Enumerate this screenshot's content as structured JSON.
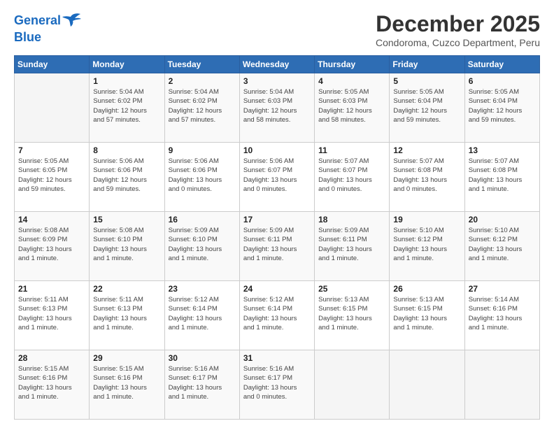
{
  "logo": {
    "line1": "General",
    "line2": "Blue"
  },
  "header": {
    "month": "December 2025",
    "location": "Condoroma, Cuzco Department, Peru"
  },
  "days_of_week": [
    "Sunday",
    "Monday",
    "Tuesday",
    "Wednesday",
    "Thursday",
    "Friday",
    "Saturday"
  ],
  "weeks": [
    [
      {
        "day": "",
        "info": ""
      },
      {
        "day": "1",
        "info": "Sunrise: 5:04 AM\nSunset: 6:02 PM\nDaylight: 12 hours\nand 57 minutes."
      },
      {
        "day": "2",
        "info": "Sunrise: 5:04 AM\nSunset: 6:02 PM\nDaylight: 12 hours\nand 57 minutes."
      },
      {
        "day": "3",
        "info": "Sunrise: 5:04 AM\nSunset: 6:03 PM\nDaylight: 12 hours\nand 58 minutes."
      },
      {
        "day": "4",
        "info": "Sunrise: 5:05 AM\nSunset: 6:03 PM\nDaylight: 12 hours\nand 58 minutes."
      },
      {
        "day": "5",
        "info": "Sunrise: 5:05 AM\nSunset: 6:04 PM\nDaylight: 12 hours\nand 59 minutes."
      },
      {
        "day": "6",
        "info": "Sunrise: 5:05 AM\nSunset: 6:04 PM\nDaylight: 12 hours\nand 59 minutes."
      }
    ],
    [
      {
        "day": "7",
        "info": "Sunrise: 5:05 AM\nSunset: 6:05 PM\nDaylight: 12 hours\nand 59 minutes."
      },
      {
        "day": "8",
        "info": "Sunrise: 5:06 AM\nSunset: 6:06 PM\nDaylight: 12 hours\nand 59 minutes."
      },
      {
        "day": "9",
        "info": "Sunrise: 5:06 AM\nSunset: 6:06 PM\nDaylight: 13 hours\nand 0 minutes."
      },
      {
        "day": "10",
        "info": "Sunrise: 5:06 AM\nSunset: 6:07 PM\nDaylight: 13 hours\nand 0 minutes."
      },
      {
        "day": "11",
        "info": "Sunrise: 5:07 AM\nSunset: 6:07 PM\nDaylight: 13 hours\nand 0 minutes."
      },
      {
        "day": "12",
        "info": "Sunrise: 5:07 AM\nSunset: 6:08 PM\nDaylight: 13 hours\nand 0 minutes."
      },
      {
        "day": "13",
        "info": "Sunrise: 5:07 AM\nSunset: 6:08 PM\nDaylight: 13 hours\nand 1 minute."
      }
    ],
    [
      {
        "day": "14",
        "info": "Sunrise: 5:08 AM\nSunset: 6:09 PM\nDaylight: 13 hours\nand 1 minute."
      },
      {
        "day": "15",
        "info": "Sunrise: 5:08 AM\nSunset: 6:10 PM\nDaylight: 13 hours\nand 1 minute."
      },
      {
        "day": "16",
        "info": "Sunrise: 5:09 AM\nSunset: 6:10 PM\nDaylight: 13 hours\nand 1 minute."
      },
      {
        "day": "17",
        "info": "Sunrise: 5:09 AM\nSunset: 6:11 PM\nDaylight: 13 hours\nand 1 minute."
      },
      {
        "day": "18",
        "info": "Sunrise: 5:09 AM\nSunset: 6:11 PM\nDaylight: 13 hours\nand 1 minute."
      },
      {
        "day": "19",
        "info": "Sunrise: 5:10 AM\nSunset: 6:12 PM\nDaylight: 13 hours\nand 1 minute."
      },
      {
        "day": "20",
        "info": "Sunrise: 5:10 AM\nSunset: 6:12 PM\nDaylight: 13 hours\nand 1 minute."
      }
    ],
    [
      {
        "day": "21",
        "info": "Sunrise: 5:11 AM\nSunset: 6:13 PM\nDaylight: 13 hours\nand 1 minute."
      },
      {
        "day": "22",
        "info": "Sunrise: 5:11 AM\nSunset: 6:13 PM\nDaylight: 13 hours\nand 1 minute."
      },
      {
        "day": "23",
        "info": "Sunrise: 5:12 AM\nSunset: 6:14 PM\nDaylight: 13 hours\nand 1 minute."
      },
      {
        "day": "24",
        "info": "Sunrise: 5:12 AM\nSunset: 6:14 PM\nDaylight: 13 hours\nand 1 minute."
      },
      {
        "day": "25",
        "info": "Sunrise: 5:13 AM\nSunset: 6:15 PM\nDaylight: 13 hours\nand 1 minute."
      },
      {
        "day": "26",
        "info": "Sunrise: 5:13 AM\nSunset: 6:15 PM\nDaylight: 13 hours\nand 1 minute."
      },
      {
        "day": "27",
        "info": "Sunrise: 5:14 AM\nSunset: 6:16 PM\nDaylight: 13 hours\nand 1 minute."
      }
    ],
    [
      {
        "day": "28",
        "info": "Sunrise: 5:15 AM\nSunset: 6:16 PM\nDaylight: 13 hours\nand 1 minute."
      },
      {
        "day": "29",
        "info": "Sunrise: 5:15 AM\nSunset: 6:16 PM\nDaylight: 13 hours\nand 1 minute."
      },
      {
        "day": "30",
        "info": "Sunrise: 5:16 AM\nSunset: 6:17 PM\nDaylight: 13 hours\nand 1 minute."
      },
      {
        "day": "31",
        "info": "Sunrise: 5:16 AM\nSunset: 6:17 PM\nDaylight: 13 hours\nand 0 minutes."
      },
      {
        "day": "",
        "info": ""
      },
      {
        "day": "",
        "info": ""
      },
      {
        "day": "",
        "info": ""
      }
    ]
  ]
}
